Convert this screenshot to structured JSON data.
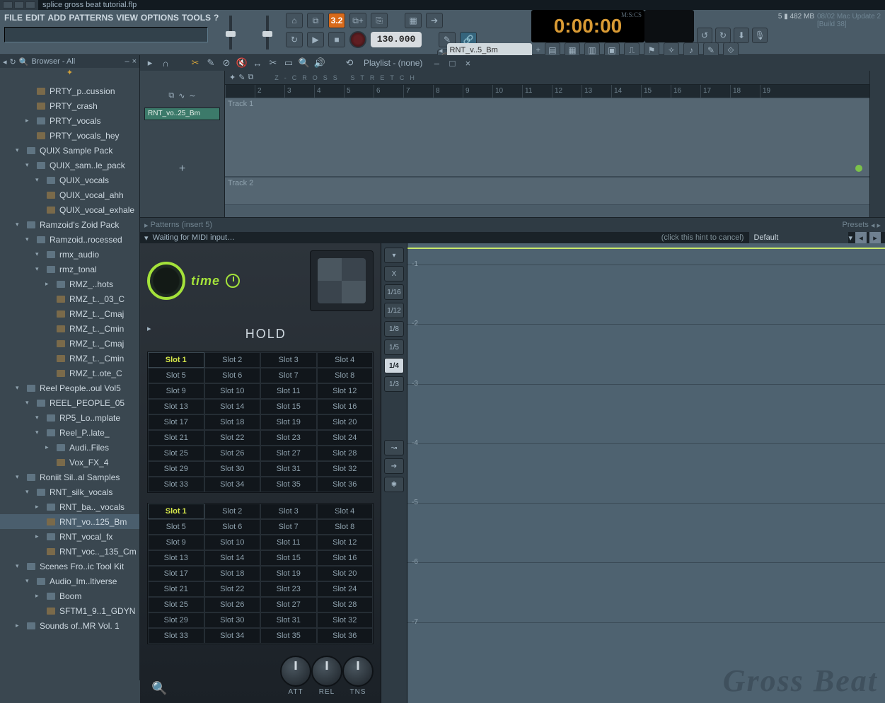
{
  "window": {
    "filename": "splice gross beat tutorial.flp"
  },
  "menus": [
    "FILE",
    "EDIT",
    "ADD",
    "PATTERNS",
    "VIEW",
    "OPTIONS",
    "TOOLS",
    "?"
  ],
  "transport": {
    "pat_number": "3.2",
    "tempo": "130.000",
    "line_mode": "Line",
    "clock": "0:00:00",
    "clock_units": "M:S:CS"
  },
  "cpu": {
    "polyphony": "5",
    "mem": "482 MB"
  },
  "news": {
    "date": "08/02",
    "title": "Mac Update 2",
    "build": "[Build 38]"
  },
  "pattern_bar": {
    "name": "RNT_v..5_Bm"
  },
  "browser": {
    "title": "Browser - All",
    "items": [
      {
        "label": "PRTY_p..cussion",
        "depth": 2,
        "icon": "audio",
        "tri": ""
      },
      {
        "label": "PRTY_crash",
        "depth": 2,
        "icon": "audio",
        "tri": ""
      },
      {
        "label": "PRTY_vocals",
        "depth": 2,
        "icon": "folder",
        "tri": "▸"
      },
      {
        "label": "PRTY_vocals_hey",
        "depth": 2,
        "icon": "audio",
        "tri": ""
      },
      {
        "label": "QUIX Sample Pack",
        "depth": 1,
        "icon": "folder",
        "tri": "▾"
      },
      {
        "label": "QUIX_sam..le_pack",
        "depth": 2,
        "icon": "folder",
        "tri": "▾"
      },
      {
        "label": "QUIX_vocals",
        "depth": 3,
        "icon": "folder",
        "tri": "▾"
      },
      {
        "label": "QUIX_vocal_ahh",
        "depth": 3,
        "icon": "audio",
        "tri": ""
      },
      {
        "label": "QUIX_vocal_exhale",
        "depth": 3,
        "icon": "audio",
        "tri": ""
      },
      {
        "label": "Ramzoid's Zoid Pack",
        "depth": 1,
        "icon": "folder",
        "tri": "▾"
      },
      {
        "label": "Ramzoid..rocessed",
        "depth": 2,
        "icon": "folder",
        "tri": "▾"
      },
      {
        "label": "rmx_audio",
        "depth": 3,
        "icon": "folder",
        "tri": "▾"
      },
      {
        "label": "rmz_tonal",
        "depth": 3,
        "icon": "folder",
        "tri": "▾"
      },
      {
        "label": "RMZ_..hots",
        "depth": 4,
        "icon": "folder",
        "tri": "▸"
      },
      {
        "label": "RMZ_t.._03_C",
        "depth": 4,
        "icon": "audio",
        "tri": ""
      },
      {
        "label": "RMZ_t.._Cmaj",
        "depth": 4,
        "icon": "audio",
        "tri": ""
      },
      {
        "label": "RMZ_t.._Cmin",
        "depth": 4,
        "icon": "audio",
        "tri": ""
      },
      {
        "label": "RMZ_t.._Cmaj",
        "depth": 4,
        "icon": "audio",
        "tri": ""
      },
      {
        "label": "RMZ_t.._Cmin",
        "depth": 4,
        "icon": "audio",
        "tri": ""
      },
      {
        "label": "RMZ_t..ote_C",
        "depth": 4,
        "icon": "audio",
        "tri": ""
      },
      {
        "label": "Reel People..oul Vol5",
        "depth": 1,
        "icon": "folder",
        "tri": "▾"
      },
      {
        "label": "REEL_PEOPLE_05",
        "depth": 2,
        "icon": "folder",
        "tri": "▾"
      },
      {
        "label": "RP5_Lo..mplate",
        "depth": 3,
        "icon": "folder",
        "tri": "▾"
      },
      {
        "label": "Reel_P..late_",
        "depth": 3,
        "icon": "folder",
        "tri": "▾"
      },
      {
        "label": "Audi..Files",
        "depth": 4,
        "icon": "folder",
        "tri": "▸"
      },
      {
        "label": "Vox_FX_4",
        "depth": 4,
        "icon": "audio",
        "tri": ""
      },
      {
        "label": "Roniit Sil..al Samples",
        "depth": 1,
        "icon": "folder",
        "tri": "▾"
      },
      {
        "label": "RNT_silk_vocals",
        "depth": 2,
        "icon": "folder",
        "tri": "▾"
      },
      {
        "label": "RNT_ba.._vocals",
        "depth": 3,
        "icon": "folder",
        "tri": "▸"
      },
      {
        "label": "RNT_vo..125_Bm",
        "depth": 3,
        "icon": "audio",
        "tri": "",
        "selected": true
      },
      {
        "label": "RNT_vocal_fx",
        "depth": 3,
        "icon": "folder",
        "tri": "▸"
      },
      {
        "label": "RNT_voc.._135_Cm",
        "depth": 3,
        "icon": "audio",
        "tri": ""
      },
      {
        "label": "Scenes Fro..ic Tool Kit",
        "depth": 1,
        "icon": "folder",
        "tri": "▾"
      },
      {
        "label": "Audio_Im..ltiverse",
        "depth": 2,
        "icon": "folder",
        "tri": "▾"
      },
      {
        "label": "Boom",
        "depth": 3,
        "icon": "folder",
        "tri": "▸"
      },
      {
        "label": "SFTM1_9..1_GDYN",
        "depth": 3,
        "icon": "audio",
        "tri": ""
      },
      {
        "label": "Sounds of..MR Vol. 1",
        "depth": 1,
        "icon": "folder",
        "tri": "▸"
      }
    ]
  },
  "playlist": {
    "title": "Playlist - (none)",
    "clip_name": "RNT_vo..25_Bm",
    "zoom_labels": {
      "zcross": "Z-CROSS",
      "stretch": "STRETCH"
    },
    "ruler_bars": [
      "",
      "2",
      "3",
      "4",
      "5",
      "6",
      "7",
      "8",
      "9",
      "10",
      "11",
      "12",
      "13",
      "14",
      "15",
      "16",
      "17",
      "18",
      "19"
    ],
    "tracks": [
      "Track 1",
      "Track 2"
    ]
  },
  "rack": {
    "title": "Patterns (insert 5)",
    "presets_label": "Presets"
  },
  "plugin": {
    "hint_text": "Waiting for MIDI input…",
    "hint_cancel": "(click this hint to cancel)",
    "preset": "Default",
    "time_label": "time",
    "hold_label": "HOLD",
    "slot_labels_a": [
      [
        "Slot 1",
        "Slot 2",
        "Slot 3",
        "Slot 4"
      ],
      [
        "Slot 5",
        "Slot 6",
        "Slot 7",
        "Slot 8"
      ],
      [
        "Slot 9",
        "Slot 10",
        "Slot 11",
        "Slot 12"
      ],
      [
        "Slot 13",
        "Slot 14",
        "Slot 15",
        "Slot 16"
      ],
      [
        "Slot 17",
        "Slot 18",
        "Slot 19",
        "Slot 20"
      ],
      [
        "Slot 21",
        "Slot 22",
        "Slot 23",
        "Slot 24"
      ],
      [
        "Slot 25",
        "Slot 26",
        "Slot 27",
        "Slot 28"
      ],
      [
        "Slot 29",
        "Slot 30",
        "Slot 31",
        "Slot 32"
      ],
      [
        "Slot 33",
        "Slot 34",
        "Slot 35",
        "Slot 36"
      ]
    ],
    "slot_labels_b": [
      [
        "Slot 1",
        "Slot 2",
        "Slot 3",
        "Slot 4"
      ],
      [
        "Slot 5",
        "Slot 6",
        "Slot 7",
        "Slot 8"
      ],
      [
        "Slot 9",
        "Slot 10",
        "Slot 11",
        "Slot 12"
      ],
      [
        "Slot 13",
        "Slot 14",
        "Slot 15",
        "Slot 16"
      ],
      [
        "Slot 17",
        "Slot 18",
        "Slot 19",
        "Slot 20"
      ],
      [
        "Slot 21",
        "Slot 22",
        "Slot 23",
        "Slot 24"
      ],
      [
        "Slot 25",
        "Slot 26",
        "Slot 27",
        "Slot 28"
      ],
      [
        "Slot 29",
        "Slot 30",
        "Slot 31",
        "Slot 32"
      ],
      [
        "Slot 33",
        "Slot 34",
        "Slot 35",
        "Slot 36"
      ]
    ],
    "active_slot_a": "Slot 1",
    "active_slot_b": "Slot 1",
    "knobs": [
      "ATT",
      "REL",
      "TNS"
    ],
    "mid_buttons": [
      "▾",
      "X",
      "1/16",
      "1/12",
      "1/8",
      "1/5",
      "1/4",
      "1/3"
    ],
    "mid_selected": "1/4",
    "mid_tools": [
      "↝",
      "➔",
      "✱"
    ],
    "y_markers": [
      "-1",
      "-2",
      "-3",
      "-4",
      "-5",
      "-6",
      "-7"
    ],
    "watermark": "Gross Beat"
  }
}
